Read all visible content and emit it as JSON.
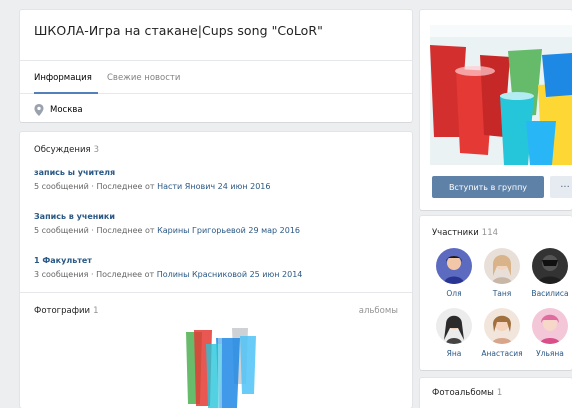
{
  "group": {
    "title": "ШКОЛА-Игра на стакане|Cups song \"CoLoR\"",
    "tabs": [
      {
        "label": "Информация"
      },
      {
        "label": "Свежие новости"
      }
    ],
    "city": "Москва"
  },
  "discussions": {
    "title": "Обсуждения",
    "count": "3",
    "topics": [
      {
        "title": "запись ы учителя",
        "count": "5 сообщений",
        "sep": "·",
        "prefix": "Последнее от",
        "author": "Насти Янович",
        "date": "24 июн 2016"
      },
      {
        "title": "Запись в ученики",
        "count": "5 сообщений",
        "sep": "·",
        "prefix": "Последнее от",
        "author": "Карины Григорьевой",
        "date": "29 мар 2016"
      },
      {
        "title": "1 Факультет",
        "count": "3 сообщения",
        "sep": "·",
        "prefix": "Последнее от",
        "author": "Полины Красниковой",
        "date": "25 июн 2014"
      }
    ]
  },
  "photos": {
    "title": "Фотографии",
    "count": "1",
    "albums_link": "альбомы"
  },
  "actions": {
    "join_label": "Вступить в группу",
    "more_label": "···"
  },
  "members": {
    "title": "Участники",
    "count": "114",
    "list": [
      {
        "name": "Оля"
      },
      {
        "name": "Таня"
      },
      {
        "name": "Василиса"
      },
      {
        "name": "Яна"
      },
      {
        "name": "Анастасия"
      },
      {
        "name": "Ульяна"
      }
    ]
  },
  "albums": {
    "title": "Фотоальбомы",
    "count": "1"
  },
  "colors": {
    "link": "#2a5885",
    "accent": "#5181b8",
    "button": "#5e81a8",
    "background": "#edeef0"
  },
  "icons": {
    "city": "map-pin-icon"
  }
}
